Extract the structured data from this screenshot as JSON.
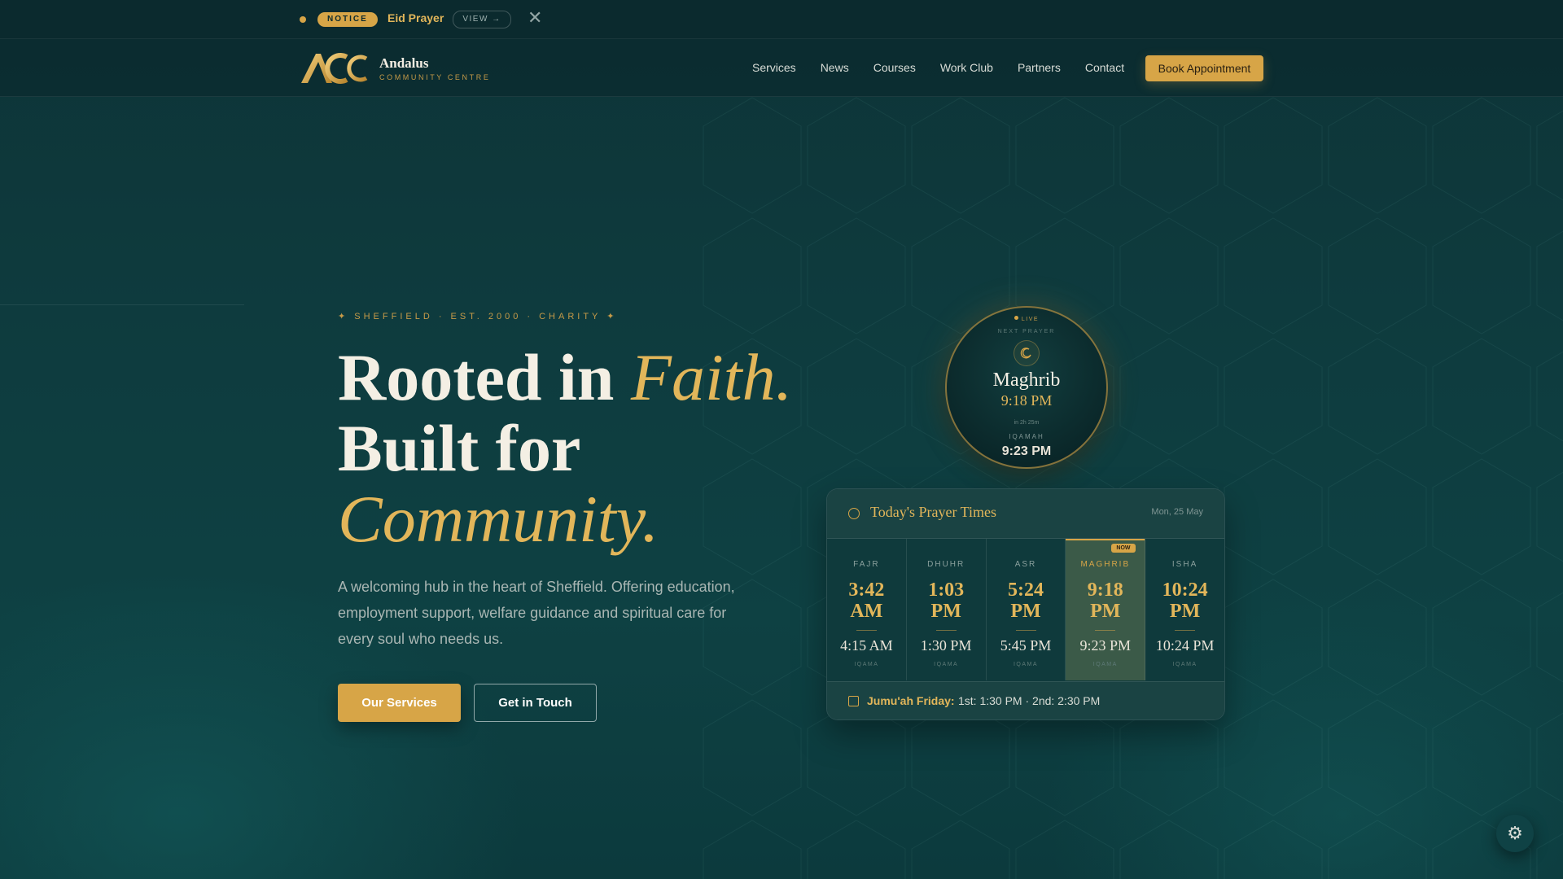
{
  "notice": {
    "badge": "NOTICE",
    "title": "Eid Prayer",
    "view_label": "VIEW →",
    "close_glyph": "✕"
  },
  "brand": {
    "name": "Andalus",
    "subtitle": "COMMUNITY CENTRE",
    "logo_text": "ACC"
  },
  "nav": {
    "items": [
      "Services",
      "News",
      "Courses",
      "Work Club",
      "Partners",
      "Contact"
    ],
    "cta": "Book Appointment"
  },
  "hero": {
    "kicker": "✦  SHEFFIELD · EST. 2000 · CHARITY  ✦",
    "title_line1": "Rooted in ",
    "title_line1_gold": "Faith.",
    "title_line2": "Built for",
    "title_line3_gold": "Community.",
    "lead": "A welcoming hub in the heart of Sheffield. Offering education, employment support, welfare guidance and spiritual care for every soul who needs us.",
    "primary_button": "Our Services",
    "secondary_button": "Get in Touch"
  },
  "next_prayer": {
    "live": "LIVE",
    "label": "NEXT PRAYER",
    "name": "Maghrib",
    "time": "9:18 PM",
    "countdown": "in 2h 25m",
    "iqamah_label": "IQAMAH",
    "iqamah_time": "9:23 PM",
    "icon": "moon-icon"
  },
  "prayer_card": {
    "title": "Today's Prayer Times",
    "date": "Mon, 25 May",
    "iqama_label": "IQAMA",
    "now_badge": "NOW",
    "prayers": [
      {
        "name": "FAJR",
        "time_top": "3:42",
        "time_bottom": "AM",
        "iqama": "4:15 AM"
      },
      {
        "name": "DHUHR",
        "time_top": "1:03",
        "time_bottom": "PM",
        "iqama": "1:30 PM"
      },
      {
        "name": "ASR",
        "time_top": "5:24",
        "time_bottom": "PM",
        "iqama": "5:45 PM"
      },
      {
        "name": "MAGHRIB",
        "time_top": "9:18",
        "time_bottom": "PM",
        "iqama": "9:23 PM",
        "active": true
      },
      {
        "name": "ISHA",
        "time_top": "10:24",
        "time_bottom": "PM",
        "iqama": "10:24 PM"
      }
    ],
    "jumuah_label": "Jumu'ah Friday:",
    "jumuah_times": "1st: 1:30 PM  ·  2nd: 2:30 PM"
  },
  "colors": {
    "accent": "#d7a547",
    "gold_text": "#e2b65a",
    "background": "#0e3b3e"
  },
  "settings_icon": "gear-icon"
}
